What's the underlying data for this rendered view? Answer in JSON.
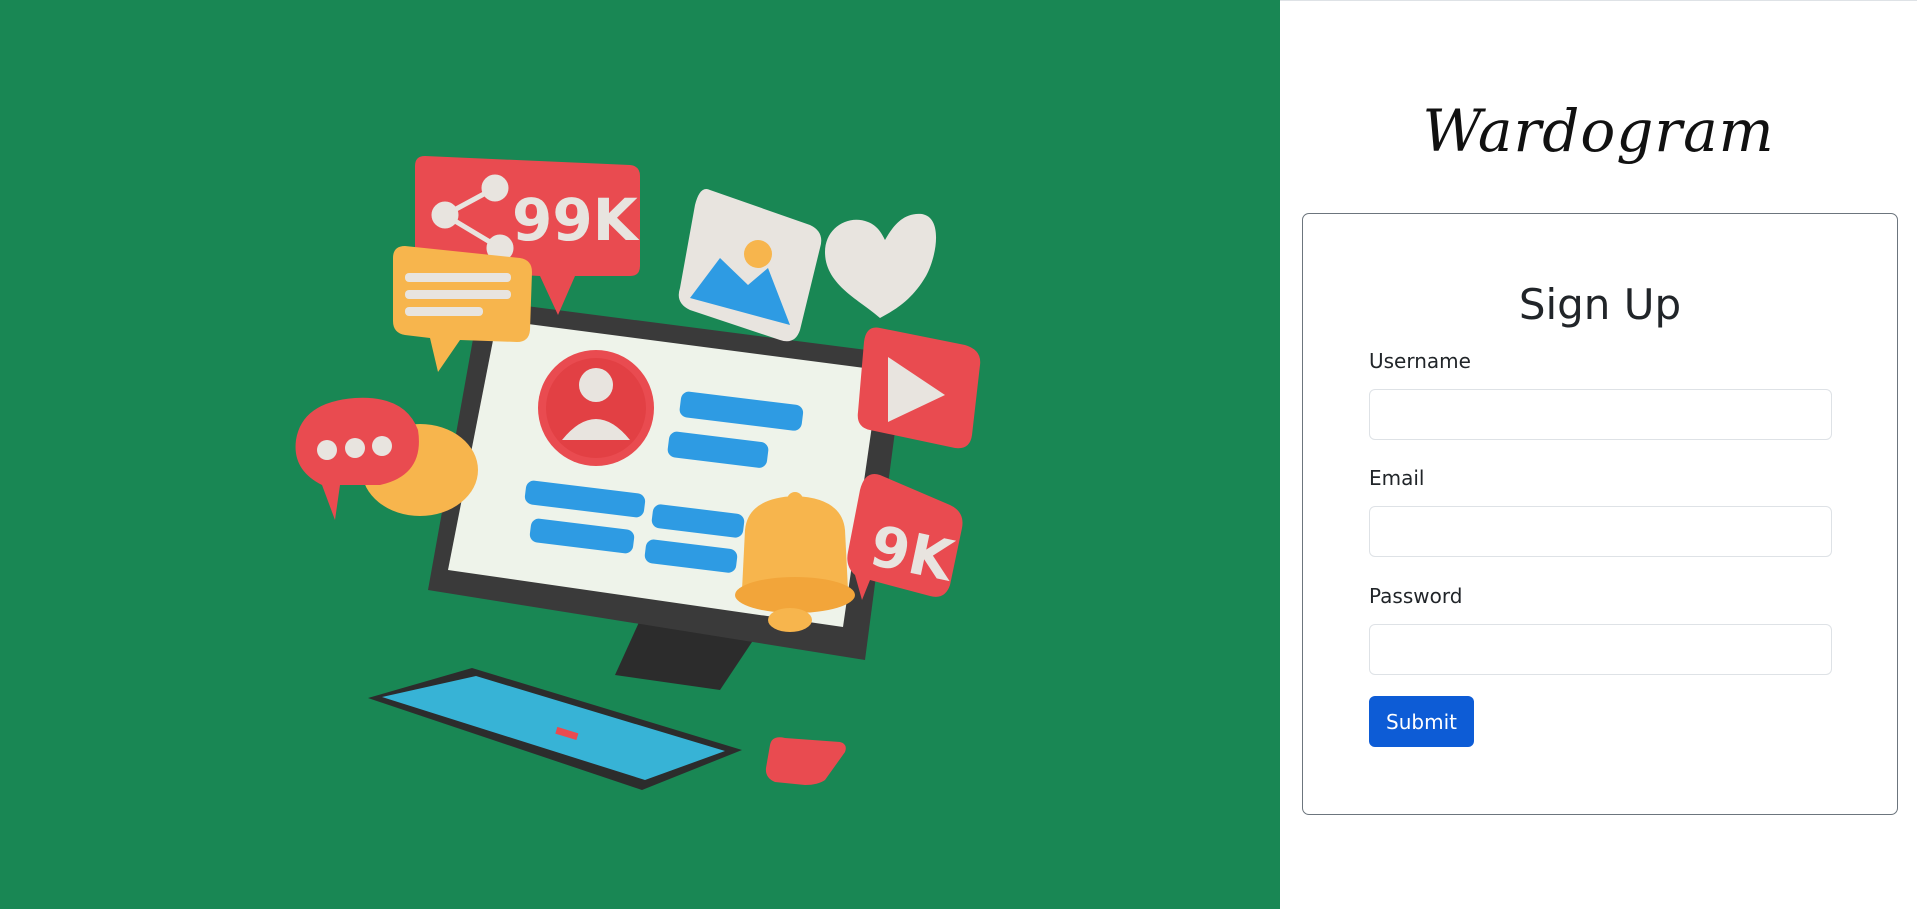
{
  "brand": {
    "name": "Wardogram"
  },
  "signup": {
    "title": "Sign Up",
    "fields": [
      {
        "label": "Username",
        "value": ""
      },
      {
        "label": "Email",
        "value": ""
      },
      {
        "label": "Password",
        "value": ""
      }
    ],
    "submit_label": "Submit"
  },
  "illustration": {
    "share_badge": "99K",
    "count_badge": "9K",
    "colors": {
      "background": "#198754",
      "red": "#e94b50",
      "yellow": "#f7b54d",
      "blue": "#2e9be3",
      "screen": "#eef3ea",
      "monitor": "#3a3a3a",
      "keyboard_keys": "#37b3d6",
      "accent_button": "#0d5cd6"
    }
  }
}
